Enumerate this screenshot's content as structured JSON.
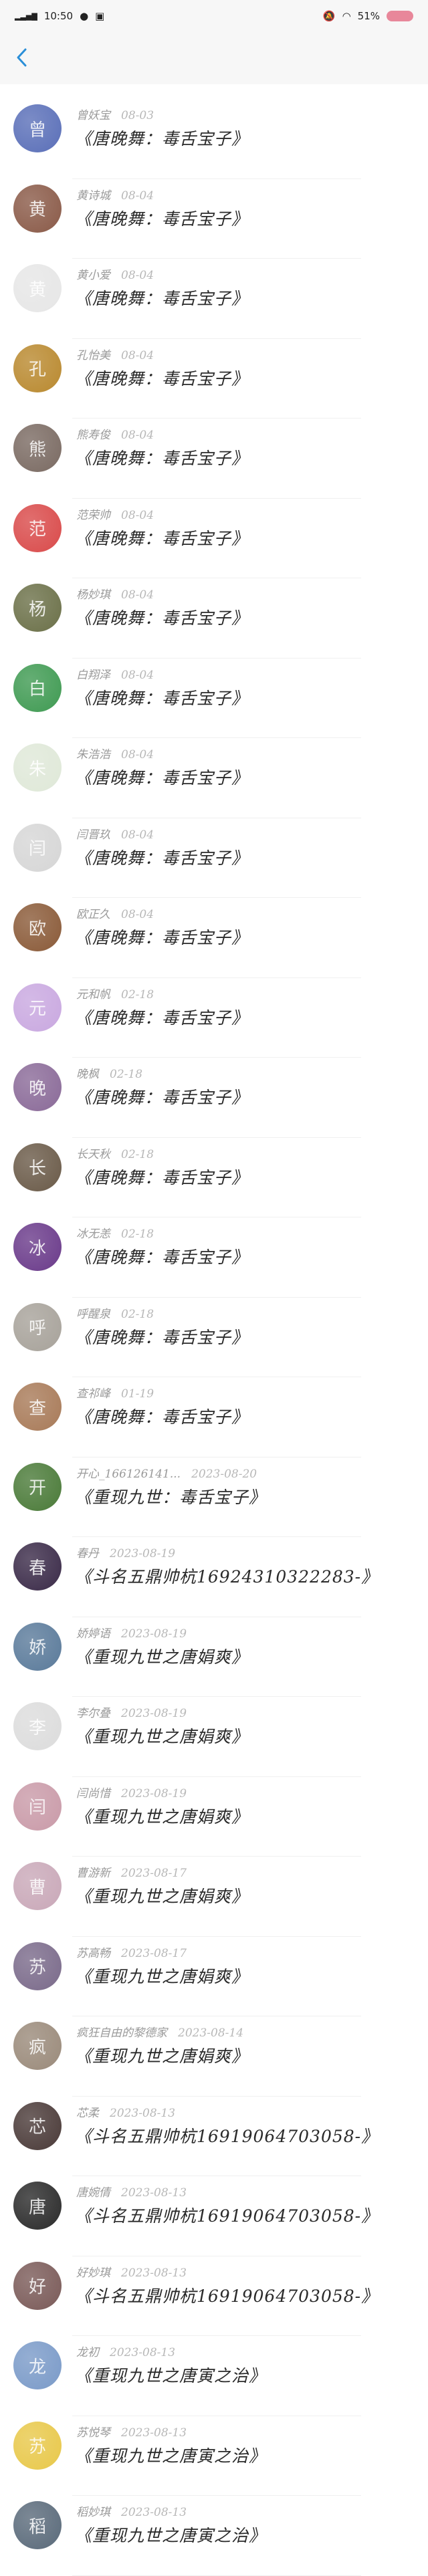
{
  "status_bar": {
    "time": "10:50",
    "battery_text": "51%",
    "icons": [
      "signal-icon",
      "notification-icon",
      "image-icon",
      "mute-icon",
      "wifi-icon",
      "battery-icon"
    ]
  },
  "nav": {
    "back_icon": "chevron-left-icon",
    "accent": "#2b8fd8"
  },
  "entries": [
    {
      "name": "曾妖宝",
      "date": "08-03",
      "title": "《唐晚舞：毒舌宝子》",
      "avatar_color": "#5a6fb8"
    },
    {
      "name": "黄诗城",
      "date": "08-04",
      "title": "《唐晚舞：毒舌宝子》",
      "avatar_color": "#8a5a48"
    },
    {
      "name": "黄小爱",
      "date": "08-04",
      "title": "《唐晚舞：毒舌宝子》",
      "avatar_color": "#e6e6e6"
    },
    {
      "name": "孔怡美",
      "date": "08-04",
      "title": "《唐晚舞：毒舌宝子》",
      "avatar_color": "#b9892f"
    },
    {
      "name": "熊寿俊",
      "date": "08-04",
      "title": "《唐晚舞：毒舌宝子》",
      "avatar_color": "#7a6a62"
    },
    {
      "name": "范荣帅",
      "date": "08-04",
      "title": "《唐晚舞：毒舌宝子》",
      "avatar_color": "#d94a4a"
    },
    {
      "name": "杨妙琪",
      "date": "08-04",
      "title": "《唐晚舞：毒舌宝子》",
      "avatar_color": "#6b7048"
    },
    {
      "name": "白翔泽",
      "date": "08-04",
      "title": "《唐晚舞：毒舌宝子》",
      "avatar_color": "#3f9a52"
    },
    {
      "name": "朱浩浩",
      "date": "08-04",
      "title": "《唐晚舞：毒舌宝子》",
      "avatar_color": "#dfe8d8"
    },
    {
      "name": "闫晋玖",
      "date": "08-04",
      "title": "《唐晚舞：毒舌宝子》",
      "avatar_color": "#d6d6d6"
    },
    {
      "name": "欧正久",
      "date": "08-04",
      "title": "《唐晚舞：毒舌宝子》",
      "avatar_color": "#8a5a38"
    },
    {
      "name": "元和帆",
      "date": "02-18",
      "title": "《唐晚舞：毒舌宝子》",
      "avatar_color": "#c9a8e0"
    },
    {
      "name": "晚枫",
      "date": "02-18",
      "title": "《唐晚舞：毒舌宝子》",
      "avatar_color": "#8a6a98"
    },
    {
      "name": "长天秋",
      "date": "02-18",
      "title": "《唐晚舞：毒舌宝子》",
      "avatar_color": "#6a5a48"
    },
    {
      "name": "冰无恙",
      "date": "02-18",
      "title": "《唐晚舞：毒舌宝子》",
      "avatar_color": "#6a3a8a"
    },
    {
      "name": "呼醒泉",
      "date": "02-18",
      "title": "《唐晚舞：毒舌宝子》",
      "avatar_color": "#a7a29a"
    },
    {
      "name": "查祁峰",
      "date": "01-19",
      "title": "《唐晚舞：毒舌宝子》",
      "avatar_color": "#a87a58"
    },
    {
      "name": "开心_166126141...",
      "date": "2023-08-20",
      "title": "《重现九世：毒舌宝子》",
      "avatar_color": "#4a7a38"
    },
    {
      "name": "春丹",
      "date": "2023-08-19",
      "title": "《斗名五鼎帅杭16924310322283-》",
      "avatar_color": "#3a2a48"
    },
    {
      "name": "娇婷语",
      "date": "2023-08-19",
      "title": "《重现九世之唐娟爽》",
      "avatar_color": "#5a7a9a"
    },
    {
      "name": "李尔叠",
      "date": "2023-08-19",
      "title": "《重现九世之唐娟爽》",
      "avatar_color": "#dcdcdc"
    },
    {
      "name": "闫尚惜",
      "date": "2023-08-19",
      "title": "《重现九世之唐娟爽》",
      "avatar_color": "#c99aa8"
    },
    {
      "name": "曹游新",
      "date": "2023-08-17",
      "title": "《重现九世之唐娟爽》",
      "avatar_color": "#c9a8b8"
    },
    {
      "name": "苏高畅",
      "date": "2023-08-17",
      "title": "《重现九世之唐娟爽》",
      "avatar_color": "#7a6a8a"
    },
    {
      "name": "疯狂自由的黎德家",
      "date": "2023-08-14",
      "title": "《重现九世之唐娟爽》",
      "avatar_color": "#9a8a7a"
    },
    {
      "name": "芯柔",
      "date": "2023-08-13",
      "title": "《斗名五鼎帅杭16919064703058-》",
      "avatar_color": "#4a3a38"
    },
    {
      "name": "唐婉倩",
      "date": "2023-08-13",
      "title": "《斗名五鼎帅杭16919064703058-》",
      "avatar_color": "#2a2a2a"
    },
    {
      "name": "好妙琪",
      "date": "2023-08-13",
      "title": "《斗名五鼎帅杭16919064703058-》",
      "avatar_color": "#7a5a58"
    },
    {
      "name": "龙初",
      "date": "2023-08-13",
      "title": "《重现九世之唐寅之治》",
      "avatar_color": "#7a9ac8"
    },
    {
      "name": "苏悦琴",
      "date": "2023-08-13",
      "title": "《重现九世之唐寅之治》",
      "avatar_color": "#e8c84a"
    },
    {
      "name": "稻妙琪",
      "date": "2023-08-13",
      "title": "《重现九世之唐寅之治》",
      "avatar_color": "#5a6a7a"
    }
  ]
}
